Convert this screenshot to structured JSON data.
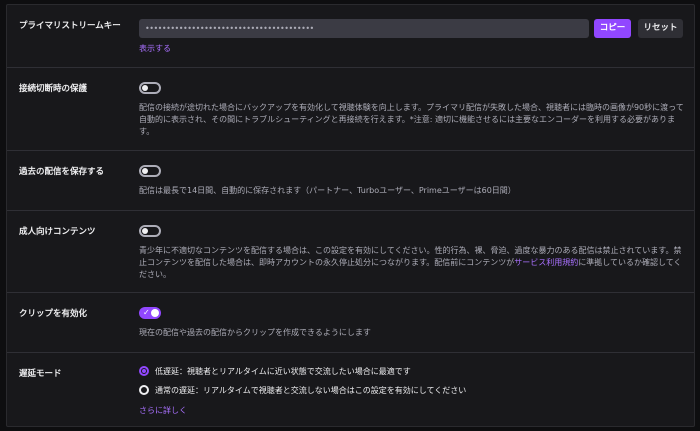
{
  "stream_key": {
    "label": "プライマリストリームキー",
    "masked_value": "••••••••••••••••••••••••••••••••••••••••",
    "copy_button": "コピー",
    "reset_button": "リセット",
    "show_link": "表示する"
  },
  "disconnect_protection": {
    "label": "接続切断時の保護",
    "enabled": false,
    "description": "配信の接続が途切れた場合にバックアップを有効化して視聴体験を向上します。プライマリ配信が失敗した場合、視聴者には臨時の画像が90秒に渡って自動的に表示され、その間にトラブルシューティングと再接続を行えます。*注意: 適切に機能させるには主要なエンコーダーを利用する必要があります。"
  },
  "store_past_broadcasts": {
    "label": "過去の配信を保存する",
    "enabled": false,
    "description": "配信は最長で14日間、自動的に保存されます（パートナー、Turboユーザー、Primeユーザーは60日間）"
  },
  "mature_content": {
    "label": "成人向けコンテンツ",
    "enabled": false,
    "description_before": "青少年に不適切なコンテンツを配信する場合は、この設定を有効にしてください。性的行為、裸、脅迫、過度な暴力のある配信は禁止されています。禁止コンテンツを配信した場合は、即時アカウントの永久停止処分につながります。配信前にコンテンツが",
    "tos_link": "サービス利用規約",
    "description_after": "に準拠しているか確認してください。"
  },
  "enable_clips": {
    "label": "クリップを有効化",
    "enabled": true,
    "description": "現在の配信や過去の配信からクリップを作成できるようにします"
  },
  "latency_mode": {
    "label": "遅延モード",
    "options": [
      {
        "label": "低遅延：視聴者とリアルタイムに近い状態で交流したい場合に最適です",
        "selected": true
      },
      {
        "label": "通常の遅延：リアルタイムで視聴者と交流しない場合はこの設定を有効にしてください",
        "selected": false
      }
    ],
    "more_link": "さらに詳しく"
  },
  "colors": {
    "accent": "#9147ff",
    "link": "#a970ff",
    "background": "#0e0e10",
    "panel": "#18181b"
  }
}
